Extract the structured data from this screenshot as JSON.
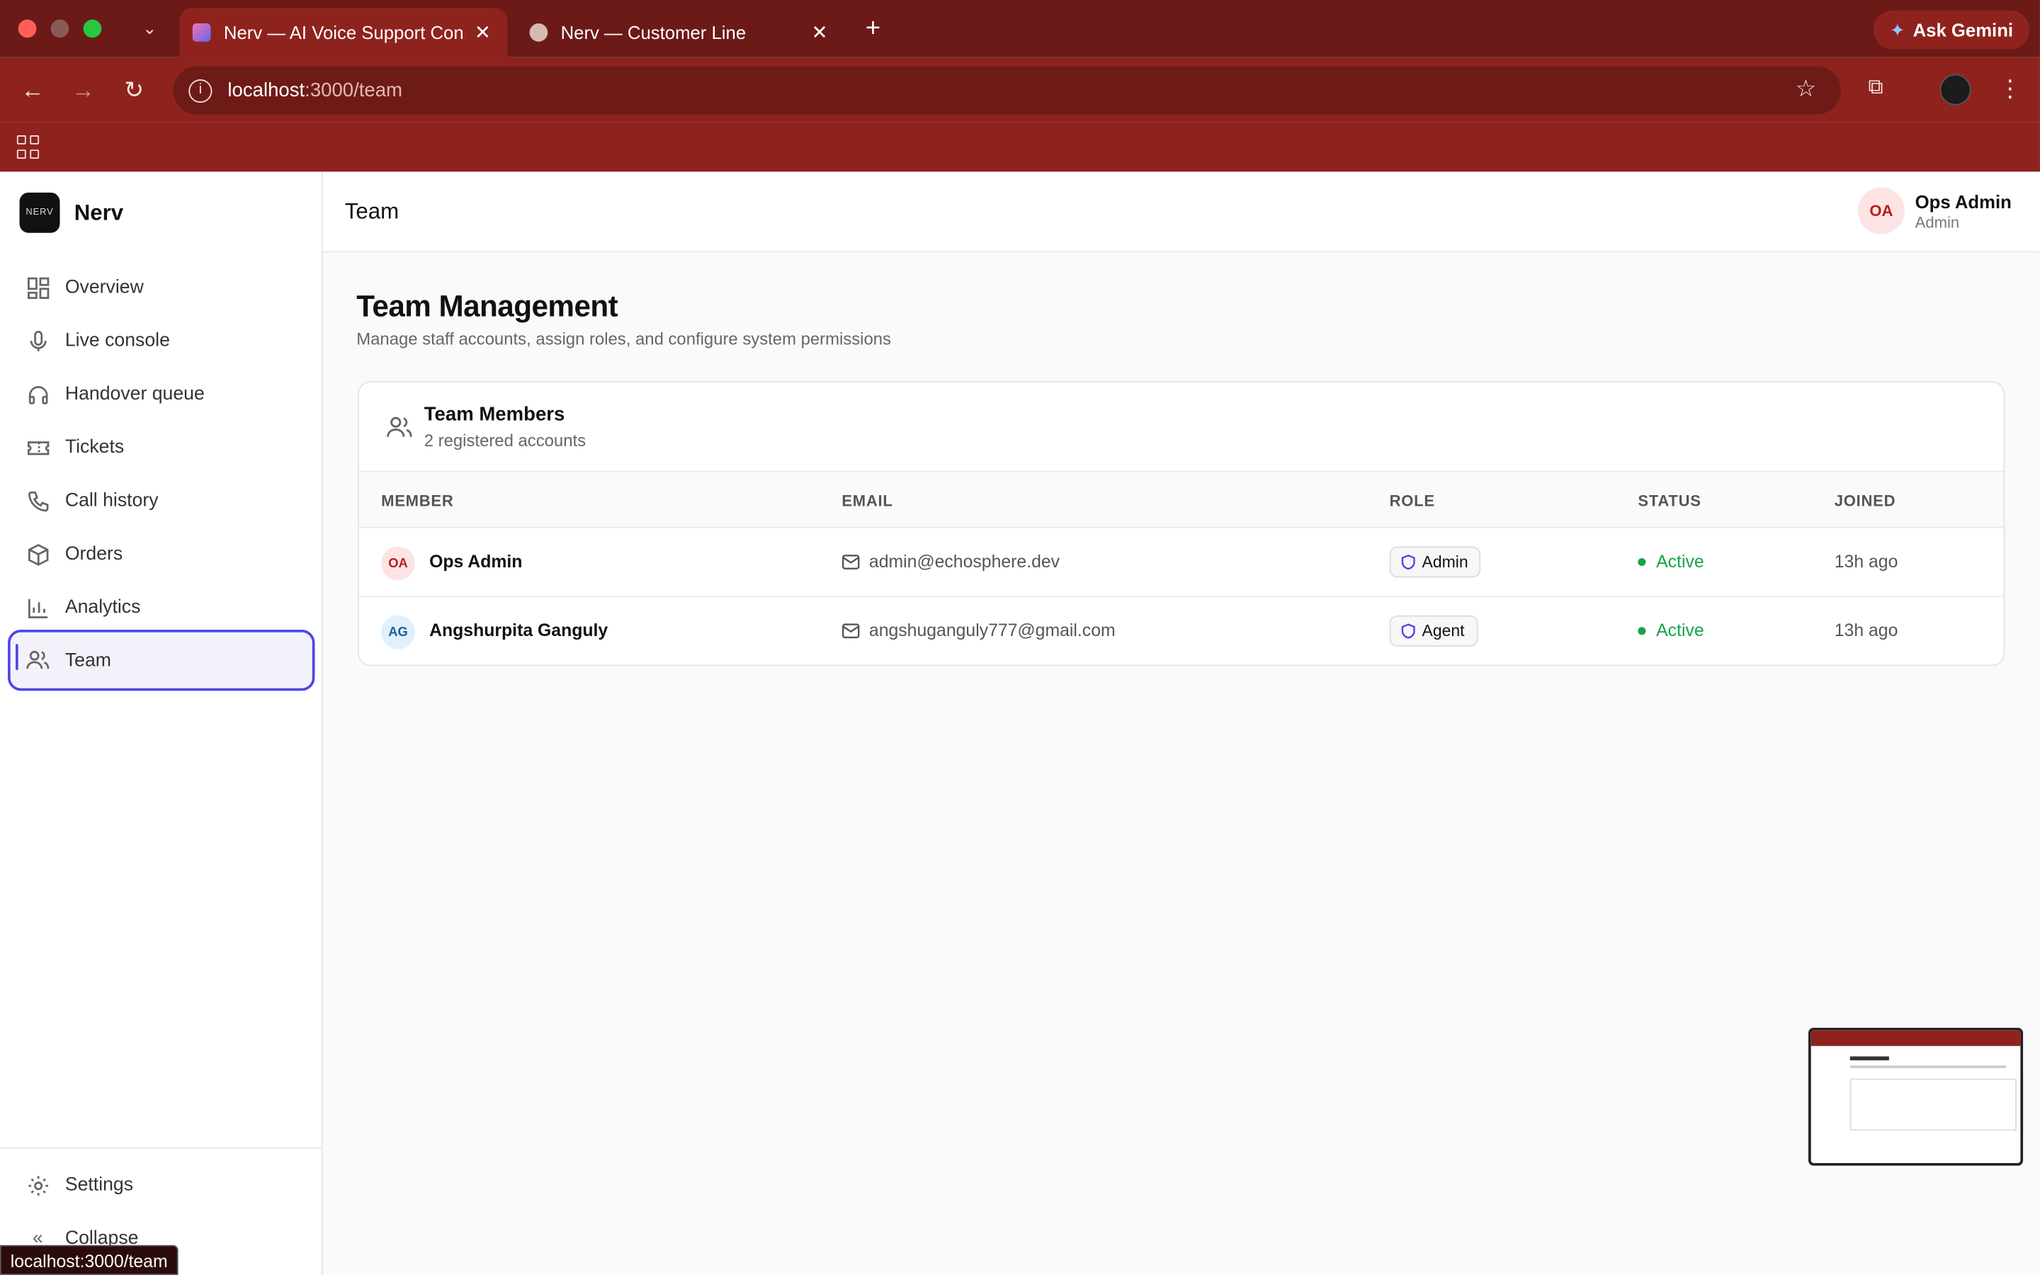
{
  "browser": {
    "tabs": [
      {
        "title": "Nerv — AI Voice Support Con",
        "active": true
      },
      {
        "title": "Nerv — Customer Line",
        "active": false
      }
    ],
    "gemini_label": "Ask Gemini",
    "url_host": "localhost",
    "url_path": ":3000/team",
    "status_url": "localhost:3000/team"
  },
  "sidebar": {
    "brand": "Nerv",
    "logo_text": "NERV",
    "items": [
      {
        "label": "Overview",
        "icon": "grid-icon"
      },
      {
        "label": "Live console",
        "icon": "mic-icon"
      },
      {
        "label": "Handover queue",
        "icon": "headphones-icon"
      },
      {
        "label": "Tickets",
        "icon": "ticket-icon"
      },
      {
        "label": "Call history",
        "icon": "phone-icon"
      },
      {
        "label": "Orders",
        "icon": "package-icon"
      },
      {
        "label": "Analytics",
        "icon": "bar-chart-icon"
      },
      {
        "label": "Team",
        "icon": "users-icon",
        "active": true
      }
    ],
    "settings_label": "Settings",
    "collapse_label": "Collapse"
  },
  "header": {
    "breadcrumb": "Team",
    "user_initials": "OA",
    "user_name": "Ops Admin",
    "user_role": "Admin"
  },
  "page": {
    "title": "Team Management",
    "subtitle": "Manage staff accounts, assign roles, and configure system permissions"
  },
  "card": {
    "title": "Team Members",
    "subtitle": "2 registered accounts",
    "columns": [
      "MEMBER",
      "EMAIL",
      "ROLE",
      "STATUS",
      "JOINED"
    ],
    "rows": [
      {
        "initials": "OA",
        "name": "Ops Admin",
        "email": "admin@echosphere.dev",
        "role": "Admin",
        "status": "Active",
        "joined": "13h ago"
      },
      {
        "initials": "AG",
        "name": "Angshurpita Ganguly",
        "email": "angshuganguly777@gmail.com",
        "role": "Agent",
        "status": "Active",
        "joined": "13h ago"
      }
    ]
  },
  "colors": {
    "accent": "#4f46e5",
    "chrome": "#8e231e",
    "status_active": "#16a34a"
  }
}
